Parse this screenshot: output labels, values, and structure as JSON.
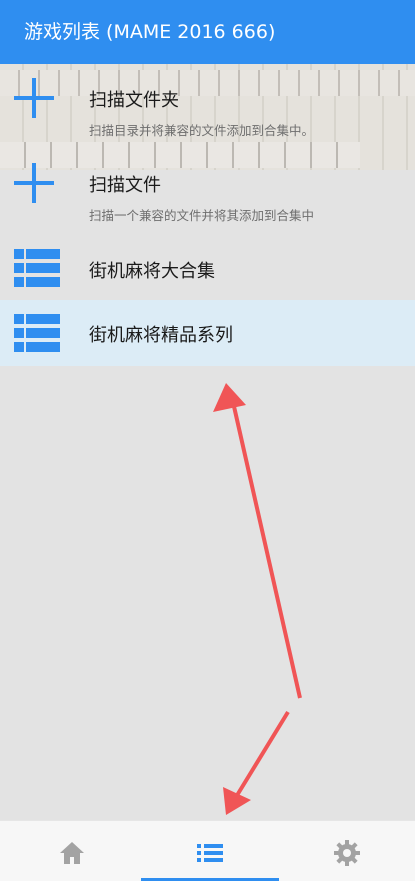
{
  "header": {
    "title": "游戏列表 (MAME 2016 666)"
  },
  "items": [
    {
      "title": "扫描文件夹",
      "subtitle": "扫描目录并将兼容的文件添加到合集中。",
      "icon": "plus-icon"
    },
    {
      "title": "扫描文件",
      "subtitle": "扫描一个兼容的文件并将其添加到合集中",
      "icon": "plus-icon"
    },
    {
      "title": "街机麻将大合集",
      "icon": "list-icon"
    },
    {
      "title": "街机麻将精品系列",
      "icon": "list-icon",
      "selected": true
    }
  ],
  "tabs": [
    {
      "name": "home",
      "icon": "home-icon"
    },
    {
      "name": "list",
      "icon": "list-icon",
      "active": true
    },
    {
      "name": "settings",
      "icon": "gear-icon"
    }
  ],
  "colors": {
    "accent": "#2f8ef0",
    "annotation": "#f05556",
    "background": "#e3e3e3"
  }
}
